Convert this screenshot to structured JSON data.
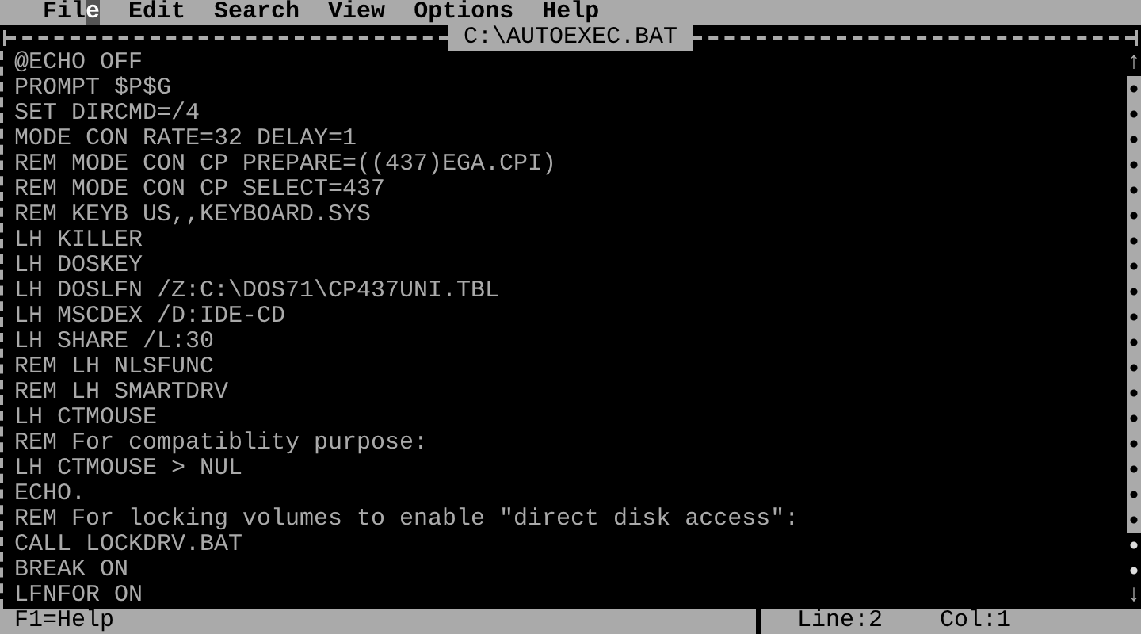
{
  "menu": [
    {
      "label": "File"
    },
    {
      "label": "Edit"
    },
    {
      "label": "Search"
    },
    {
      "label": "View"
    },
    {
      "label": "Options"
    },
    {
      "label": "Help"
    }
  ],
  "window": {
    "title": "C:\\AUTOEXEC.BAT"
  },
  "editor": {
    "lines": [
      "@ECHO OFF",
      "PROMPT $P$G",
      "SET DIRCMD=/4",
      "MODE CON RATE=32 DELAY=1",
      "REM MODE CON CP PREPARE=((437)EGA.CPI)",
      "REM MODE CON CP SELECT=437",
      "REM KEYB US,,KEYBOARD.SYS",
      "LH KILLER",
      "LH DOSKEY",
      "LH DOSLFN /Z:C:\\DOS71\\CP437UNI.TBL",
      "LH MSCDEX /D:IDE-CD",
      "LH SHARE /L:30",
      "REM LH NLSFUNC",
      "REM LH SMARTDRV",
      "LH CTMOUSE",
      "REM For compatiblity purpose:",
      "LH CTMOUSE > NUL",
      "ECHO.",
      "REM For locking volumes to enable \"direct disk access\":",
      "CALL LOCKDRV.BAT",
      "BREAK ON",
      "LFNFOR ON"
    ],
    "scroll_up": "↑",
    "scroll_down": "↓"
  },
  "status_bar": {
    "help": "F1=Help",
    "line": "Line:2",
    "col": "Col:1"
  }
}
